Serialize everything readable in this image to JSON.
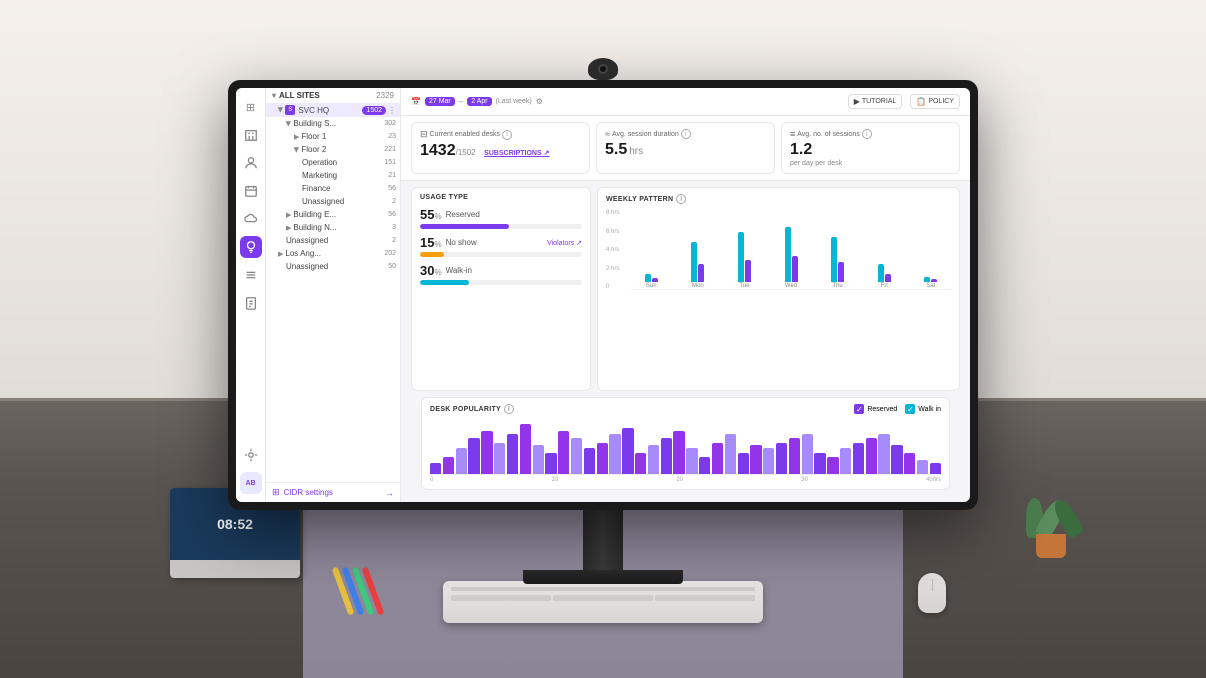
{
  "room": {
    "bg_color": "#e8e4df"
  },
  "monitor": {
    "webcam_label": "webcam"
  },
  "app": {
    "sidebar_icons": [
      {
        "name": "home-icon",
        "symbol": "⊞",
        "active": false
      },
      {
        "name": "building-icon",
        "symbol": "▤",
        "active": false
      },
      {
        "name": "people-icon",
        "symbol": "👤",
        "active": false
      },
      {
        "name": "calendar-icon",
        "symbol": "📅",
        "active": false
      },
      {
        "name": "cloud-icon",
        "symbol": "☁",
        "active": false
      },
      {
        "name": "bulb-icon",
        "symbol": "💡",
        "active": true
      },
      {
        "name": "list-icon",
        "symbol": "☰",
        "active": false
      },
      {
        "name": "doc-icon",
        "symbol": "📄",
        "active": false
      }
    ],
    "nav_bottom_icons": [
      {
        "name": "settings-icon",
        "symbol": "⚙"
      },
      {
        "name": "user-icon",
        "symbol": "AB"
      }
    ],
    "tree": {
      "header": "ALL SITES",
      "header_count": "2329",
      "items": [
        {
          "label": "SVC HQ",
          "count": "1502",
          "indent": 1,
          "badge": "1502",
          "has_icon": true,
          "expanded": true,
          "active": true
        },
        {
          "label": "Building S...",
          "count": "302",
          "indent": 2,
          "expanded": true
        },
        {
          "label": "Floor 1",
          "count": "23",
          "indent": 3
        },
        {
          "label": "Floor 2",
          "count": "221",
          "indent": 3,
          "expanded": true
        },
        {
          "label": "Operation",
          "count": "151",
          "indent": 4
        },
        {
          "label": "Marketing",
          "count": "21",
          "indent": 4
        },
        {
          "label": "Finance",
          "count": "56",
          "indent": 4
        },
        {
          "label": "Unassigned",
          "count": "2",
          "indent": 4
        },
        {
          "label": "Building E...",
          "count": "56",
          "indent": 2
        },
        {
          "label": "Building N...",
          "count": "3",
          "indent": 2
        },
        {
          "label": "Unassigned",
          "count": "2",
          "indent": 2
        },
        {
          "label": "Los Ang...",
          "count": "202",
          "indent": 1
        },
        {
          "label": "Unassigned",
          "count": "50",
          "indent": 2
        }
      ],
      "footer_label": "CIDR settings"
    },
    "header": {
      "date_icon": "📅",
      "date_start": "27 Mar",
      "date_end": "2 Apr",
      "last_week_label": "(Last week)",
      "settings_icon": "⚙",
      "tutorial_label": "TUTORIAL",
      "policy_label": "POLICY"
    },
    "metrics": [
      {
        "title": "Current enabled desks",
        "value": "1432",
        "value_sub": "/1502",
        "link": "SUBSCRIPTIONS",
        "unit": ""
      },
      {
        "title": "Avg. session duration",
        "value": "5.5",
        "unit": "hrs",
        "sub": ""
      },
      {
        "title": "Avg. no. of sessions",
        "value": "1.2",
        "unit": "",
        "sub": "per day per desk"
      }
    ],
    "usage_type": {
      "title": "USAGE TYPE",
      "items": [
        {
          "label": "Reserved",
          "pct": 55,
          "color": "#7c3aed"
        },
        {
          "label": "No show",
          "pct": 15,
          "color": "#f59e0b"
        },
        {
          "label": "Walk-in",
          "pct": 30,
          "color": "#06b6d4"
        }
      ],
      "violators_label": "Violators ↗"
    },
    "weekly_pattern": {
      "title": "WEEKLY PATTERN",
      "y_labels": [
        "8 hrs",
        "6 hrs",
        "4 hrs",
        "2 hrs",
        "0"
      ],
      "days": [
        {
          "label": "Sun",
          "reserved": 10,
          "walkin": 5
        },
        {
          "label": "Mon",
          "reserved": 45,
          "walkin": 20
        },
        {
          "label": "Tue",
          "reserved": 55,
          "walkin": 25
        },
        {
          "label": "Wed",
          "reserved": 60,
          "walkin": 30
        },
        {
          "label": "Thu",
          "reserved": 50,
          "walkin": 22
        },
        {
          "label": "Fri",
          "reserved": 20,
          "walkin": 10
        },
        {
          "label": "Sat",
          "reserved": 5,
          "walkin": 3
        }
      ],
      "colors": {
        "reserved": "#06b6d4",
        "walkin": "#7c3aed"
      }
    },
    "desk_popularity": {
      "title": "DESK POPULARITY",
      "legend": [
        {
          "label": "Reserved",
          "color": "#7c3aed",
          "checked": true
        },
        {
          "label": "Walk in",
          "color": "#06b6d4",
          "checked": true
        }
      ],
      "bars": [
        8,
        12,
        18,
        25,
        30,
        22,
        28,
        35,
        20,
        15,
        30,
        25,
        18,
        22,
        28,
        32,
        15,
        20,
        25,
        30,
        18,
        12,
        22,
        28,
        15,
        20,
        18,
        22,
        25,
        28,
        15,
        12,
        18,
        22,
        25,
        28,
        20,
        15,
        10,
        8
      ],
      "x_labels": [
        "0",
        "10",
        "20",
        "30",
        "40hrs"
      ]
    }
  }
}
